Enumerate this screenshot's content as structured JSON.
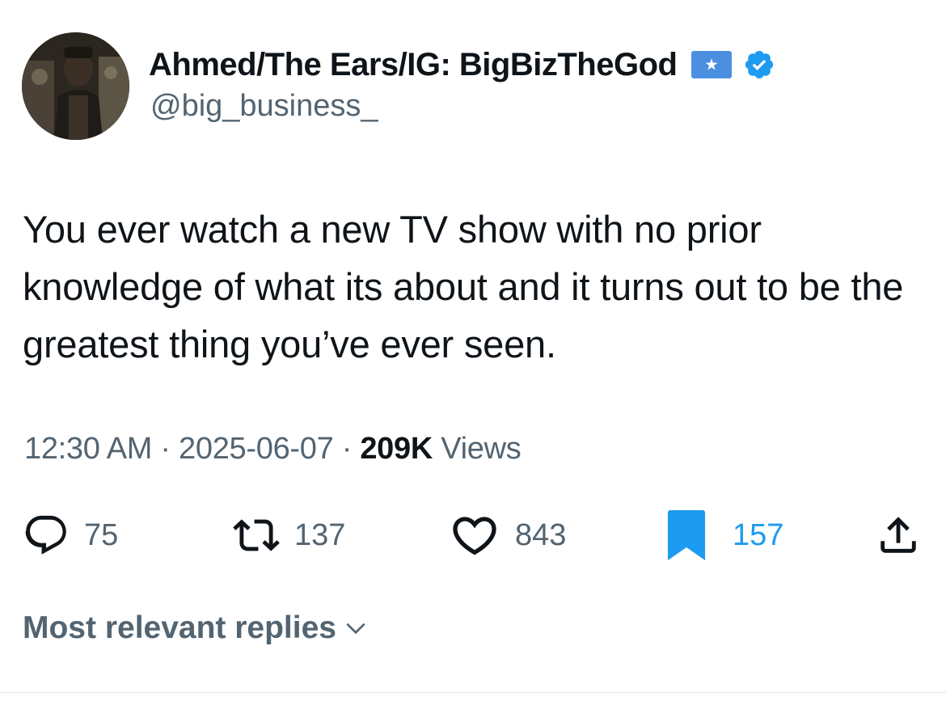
{
  "author": {
    "display_name": "Ahmed/The Ears/IG: BigBizTheGod",
    "handle": "@big_business_",
    "avatar_icon": "profile-photo",
    "flag_icon": "somalia-flag-icon",
    "verified_icon": "verified-badge-icon"
  },
  "tweet": {
    "text": "You ever watch a new TV show with no prior knowledge of what its about and it turns out to be the greatest thing you’ve ever seen.",
    "time": "12:30 AM",
    "date": "2025-06-07",
    "separator": "·",
    "views_count": "209K",
    "views_label": "Views"
  },
  "actions": {
    "replies": "75",
    "reposts": "137",
    "likes": "843",
    "bookmarks": "157"
  },
  "sort": {
    "label": "Most relevant replies"
  },
  "colors": {
    "text_primary": "#0f1419",
    "text_secondary": "#536471",
    "accent_blue": "#1d9bf0",
    "flag_blue": "#4189dd"
  }
}
